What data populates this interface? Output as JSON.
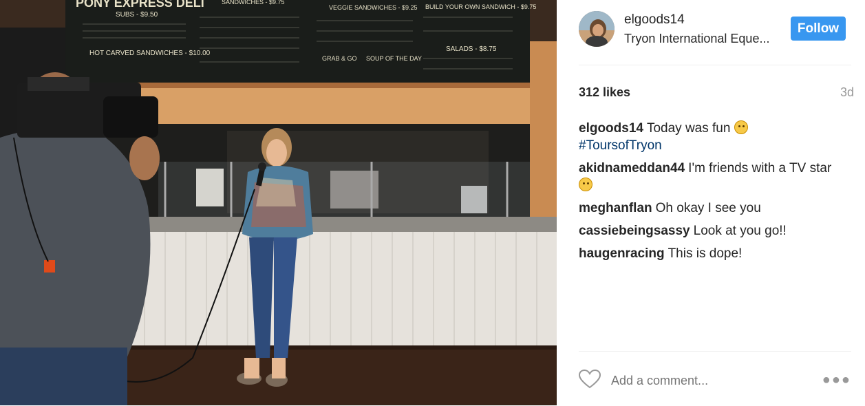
{
  "post": {
    "image_alt": "Woman holding a microphone in front of a deli counter being filmed by a cameraman",
    "menu_board": {
      "deli_title": "PONY EXPRESS DELI",
      "subs": "SUBS - $9.50",
      "sandwiches": "SANDWICHES - $9.75",
      "veggie": "VEGGIE SANDWICHES - $9.25",
      "build": "BUILD YOUR OWN SANDWICH - $9.75",
      "hot": "HOT CARVED SANDWICHES - $10.00",
      "grab": "GRAB & GO",
      "soup": "SOUP OF THE DAY",
      "salads": "SALADS - $8.75"
    }
  },
  "header": {
    "username": "elgoods14",
    "location": "Tryon International Eque...",
    "follow_label": "Follow"
  },
  "stats": {
    "likes": "312 likes",
    "time": "3d"
  },
  "comments": [
    {
      "user": "elgoods14",
      "text": "Today was fun",
      "hashtag": "#ToursofTryon"
    },
    {
      "user": "akidnameddan44",
      "text": "I'm friends with a TV star"
    },
    {
      "user": "meghanflan",
      "text": "Oh okay I see you"
    },
    {
      "user": "cassiebeingsassy",
      "text": "Look at you go!!"
    },
    {
      "user": "haugenracing",
      "text": "This is dope!"
    }
  ],
  "footer": {
    "add_comment_placeholder": "Add a comment...",
    "more_icon": "more-options-icon",
    "like_icon": "heart-icon"
  },
  "colors": {
    "accent": "#3897f0",
    "hashtag": "#003569",
    "muted": "#999999"
  }
}
